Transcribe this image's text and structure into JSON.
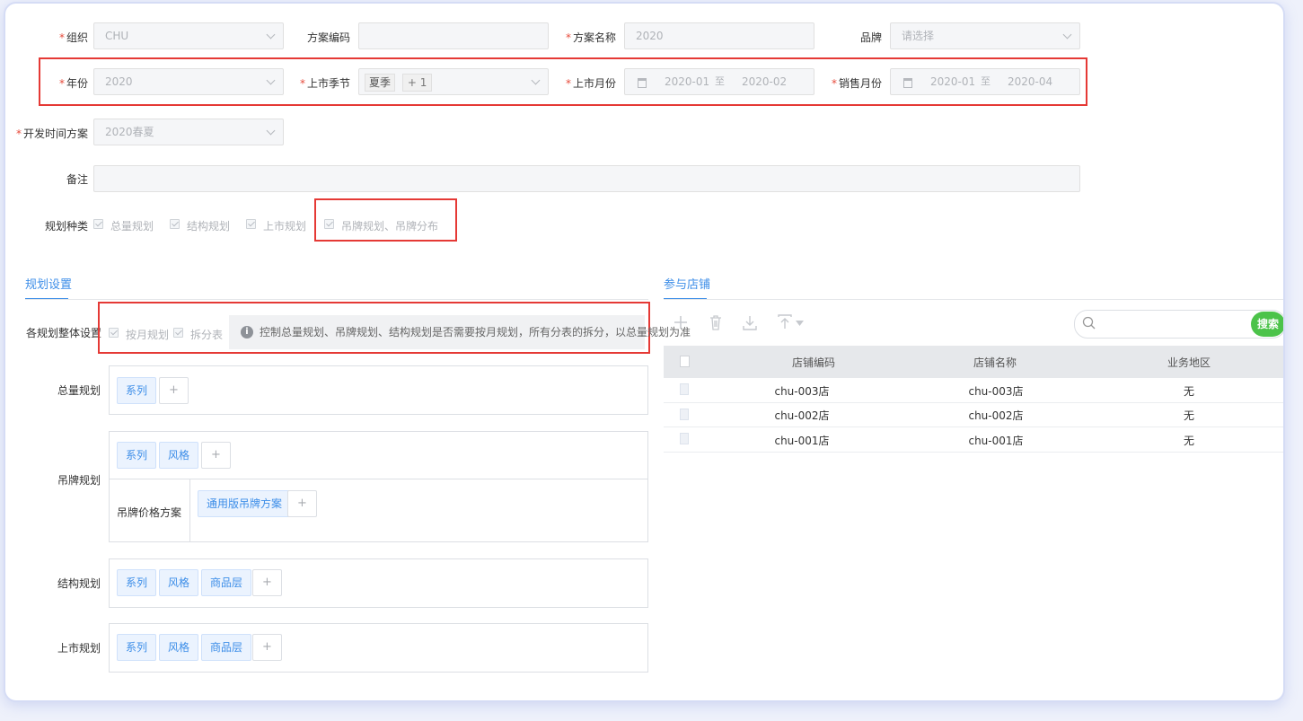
{
  "form": {
    "org": {
      "label": "组织",
      "value": "CHU"
    },
    "plan_code": {
      "label": "方案编码",
      "value": ""
    },
    "plan_name": {
      "label": "方案名称",
      "value": "2020"
    },
    "brand": {
      "label": "品牌",
      "placeholder": "请选择"
    },
    "year": {
      "label": "年份",
      "value": "2020"
    },
    "season": {
      "label": "上市季节",
      "tag": "夏季",
      "more": "+ 1"
    },
    "launch_month": {
      "label": "上市月份",
      "from": "2020-01",
      "sep": "至",
      "to": "2020-02"
    },
    "sale_month": {
      "label": "销售月份",
      "from": "2020-01",
      "sep": "至",
      "to": "2020-04"
    },
    "dev_time_plan": {
      "label": "开发时间方案",
      "value": "2020春夏"
    },
    "remark": {
      "label": "备注",
      "value": ""
    },
    "plan_types": {
      "label": "规划种类",
      "items": [
        "总量规划",
        "结构规划",
        "上市规划",
        "吊牌规划、吊牌分布"
      ]
    }
  },
  "plan_settings": {
    "tab": "规划设置",
    "overall_label": "各规划整体设置",
    "opt_monthly": "按月规划",
    "opt_split": "拆分表",
    "info_icon": "i",
    "info_text": "控制总量规划、吊牌规划、结构规划是否需要按月规划，所有分表的拆分，以总量规划为准",
    "total": {
      "label": "总量规划",
      "tags": [
        "系列"
      ]
    },
    "tagplan": {
      "label": "吊牌规划",
      "tags": [
        "系列",
        "风格"
      ],
      "price_label": "吊牌价格方案",
      "price_tags": [
        "通用版吊牌方案"
      ]
    },
    "structure": {
      "label": "结构规划",
      "tags": [
        "系列",
        "风格",
        "商品层"
      ]
    },
    "launch": {
      "label": "上市规划",
      "tags": [
        "系列",
        "风格",
        "商品层"
      ]
    },
    "add": "+"
  },
  "stores": {
    "tab": "参与店铺",
    "search_button": "搜索",
    "search_placeholder": "",
    "columns": [
      "店铺编码",
      "店铺名称",
      "业务地区"
    ],
    "rows": [
      [
        "chu-003店",
        "chu-003店",
        "无"
      ],
      [
        "chu-002店",
        "chu-002店",
        "无"
      ],
      [
        "chu-001店",
        "chu-001店",
        "无"
      ]
    ]
  },
  "icons": {
    "add": "plus-icon",
    "delete": "trash-icon",
    "download": "download-icon",
    "upload": "upload-icon",
    "search": "search-icon",
    "calendar": "calendar-icon"
  },
  "colors": {
    "accent": "#3d8ee8",
    "highlight": "#e53935",
    "search_button": "#4cc34a",
    "required": "#e74c3c"
  }
}
